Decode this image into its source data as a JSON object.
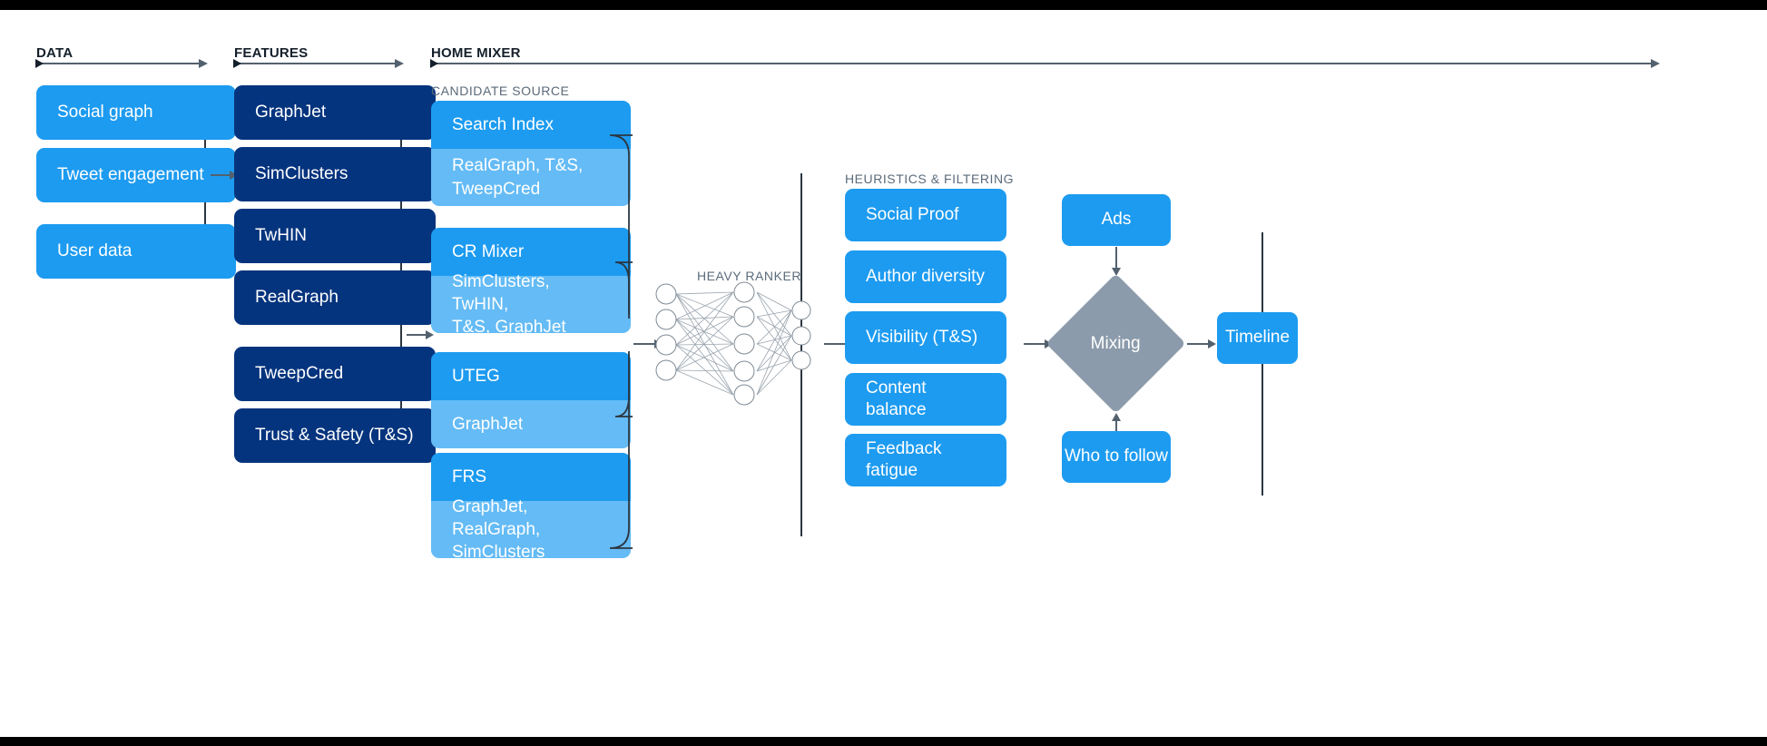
{
  "sections": [
    {
      "id": "data",
      "label": "DATA"
    },
    {
      "id": "features",
      "label": "FEATURES"
    },
    {
      "id": "home",
      "label": "HOME MIXER"
    }
  ],
  "sublabels": {
    "candidate_source": "CANDIDATE SOURCE",
    "heavy_ranker": "HEAVY RANKER",
    "heuristics": "HEURISTICS & FILTERING"
  },
  "data_boxes": [
    {
      "label": "Social graph"
    },
    {
      "label": "Tweet engagement"
    },
    {
      "label": "User data"
    }
  ],
  "feature_boxes": [
    {
      "label": "GraphJet"
    },
    {
      "label": "SimClusters"
    },
    {
      "label": "TwHIN"
    },
    {
      "label": "RealGraph"
    },
    {
      "label": "TweepCred"
    },
    {
      "label": "Trust & Safety (T&S)"
    }
  ],
  "candidate_sources": [
    {
      "title": "Search Index",
      "features": "RealGraph, T&S,\nTweepCred"
    },
    {
      "title": "CR Mixer",
      "features": "SimClusters, TwHIN,\nT&S, GraphJet"
    },
    {
      "title": "UTEG",
      "features": "GraphJet"
    },
    {
      "title": "FRS",
      "features": "GraphJet, RealGraph,\nSimClusters"
    }
  ],
  "heuristics_boxes": [
    {
      "label": "Social Proof"
    },
    {
      "label": "Author diversity"
    },
    {
      "label": "Visibility (T&S)"
    },
    {
      "label": "Content balance"
    },
    {
      "label": "Feedback fatigue"
    }
  ],
  "output": {
    "ads": "Ads",
    "mixing": "Mixing",
    "timeline": "Timeline",
    "who_to_follow": "Who to follow"
  },
  "neural_net": {
    "input_nodes": 4,
    "hidden_nodes": 5,
    "output_nodes": 3
  },
  "colors": {
    "light_blue": "#1d9bf0",
    "pale_blue": "#64bbf5",
    "navy": "#05347e",
    "slate": "#8c9bab",
    "rule": "#53616e",
    "label": "#5b6b7a",
    "black": "#000000"
  }
}
